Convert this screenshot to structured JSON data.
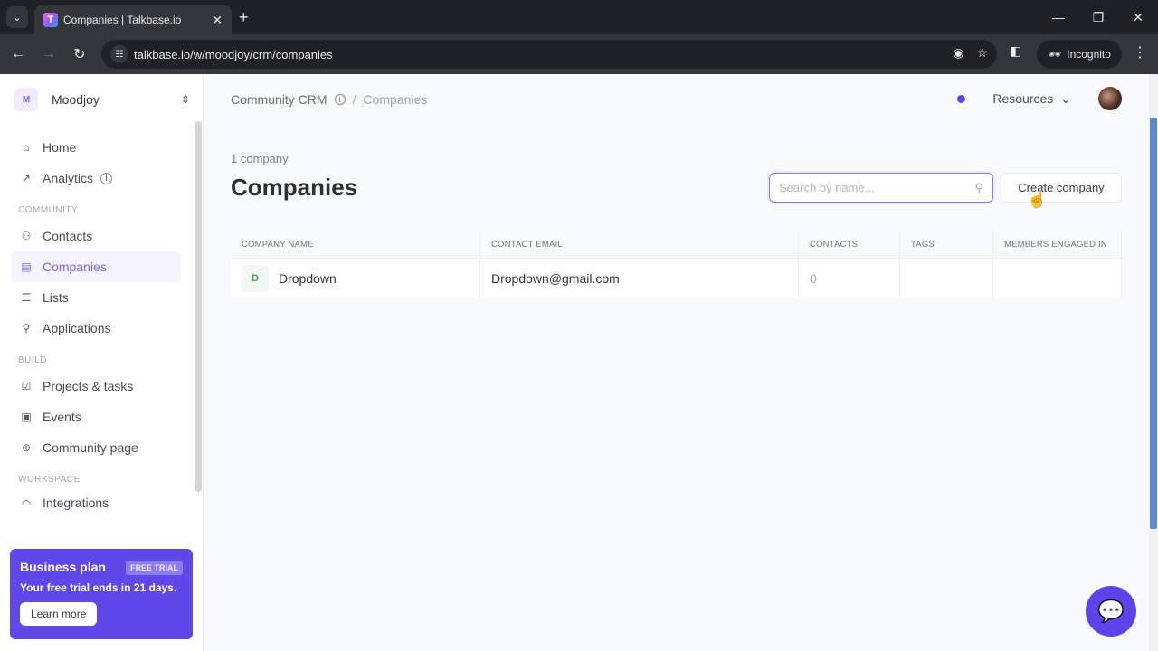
{
  "browser": {
    "tab_title": "Companies | Talkbase.io",
    "favicon_letter": "T",
    "url": "talkbase.io/w/moodjoy/crm/companies",
    "incognito_label": "Incognito"
  },
  "sidebar": {
    "workspace_initial": "M",
    "workspace_name": "Moodjoy",
    "top_items": [
      {
        "label": "Home",
        "icon": "home-icon"
      },
      {
        "label": "Analytics",
        "icon": "chart-icon"
      }
    ],
    "sections": [
      {
        "title": "COMMUNITY",
        "items": [
          {
            "label": "Contacts",
            "icon": "users-icon"
          },
          {
            "label": "Companies",
            "icon": "building-icon",
            "active": true
          },
          {
            "label": "Lists",
            "icon": "list-icon"
          },
          {
            "label": "Applications",
            "icon": "user-plus-icon"
          }
        ]
      },
      {
        "title": "BUILD",
        "items": [
          {
            "label": "Projects & tasks",
            "icon": "checkbox-icon"
          },
          {
            "label": "Events",
            "icon": "calendar-icon"
          },
          {
            "label": "Community page",
            "icon": "globe-icon"
          }
        ]
      },
      {
        "title": "WORKSPACE",
        "items": [
          {
            "label": "Integrations",
            "icon": "plug-icon"
          }
        ]
      }
    ],
    "promo": {
      "title": "Business plan",
      "badge": "FREE TRIAL",
      "text": "Your free trial ends in 21 days.",
      "button": "Learn more"
    }
  },
  "header": {
    "breadcrumb_parent": "Community CRM",
    "breadcrumb_sep": "/",
    "breadcrumb_current": "Companies",
    "resources_label": "Resources",
    "status_dot_color": "#5b45e8"
  },
  "main": {
    "count_text": "1 company",
    "title": "Companies",
    "search_placeholder": "Search by name...",
    "create_button": "Create company",
    "table": {
      "columns": [
        "COMPANY NAME",
        "CONTACT EMAIL",
        "CONTACTS",
        "TAGS",
        "MEMBERS ENGAGED IN"
      ],
      "rows": [
        {
          "initial": "D",
          "name": "Dropdown",
          "email": "Dropdown@gmail.com",
          "contacts": "0",
          "tags": "",
          "members": ""
        }
      ]
    }
  },
  "colors": {
    "accent": "#5b45e8",
    "promo_bg": "#6047e8"
  }
}
